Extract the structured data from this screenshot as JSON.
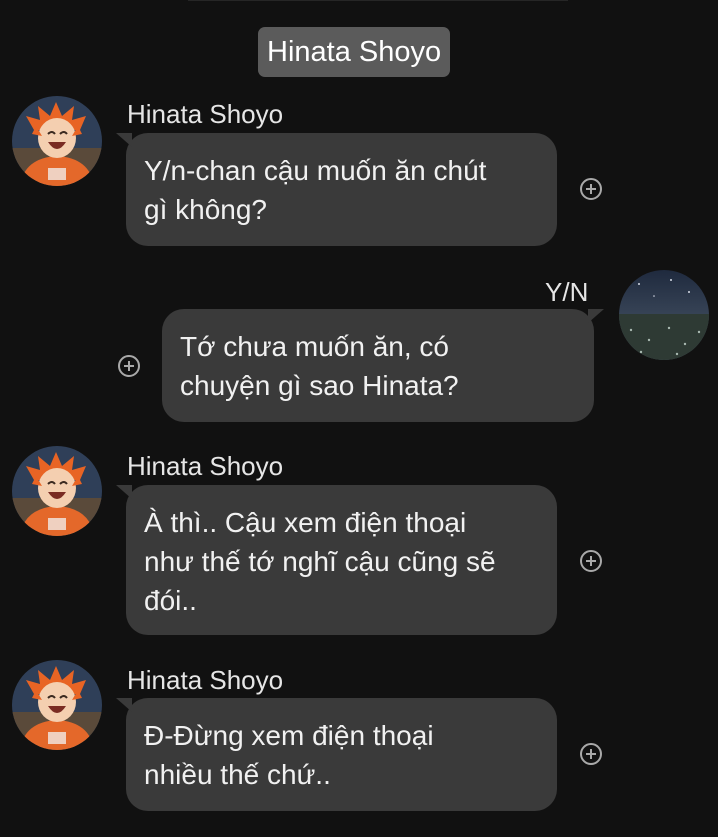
{
  "header": {
    "title": "Hinata Shoyo"
  },
  "messages": [
    {
      "sender": "Hinata Shoyo",
      "lines": [
        "Y/n-chan cậu muốn ăn chút",
        "gì không?"
      ]
    },
    {
      "sender": "Y/N",
      "lines": [
        "Tớ chưa muốn ăn, có",
        "chuyện gì sao Hinata?"
      ]
    },
    {
      "sender": "Hinata Shoyo",
      "lines": [
        "À thì.. Cậu xem điện thoại",
        "như thế tớ nghĩ cậu cũng sẽ",
        "đói.."
      ]
    },
    {
      "sender": "Hinata Shoyo",
      "lines": [
        "Đ-Đừng xem điện thoại",
        "nhiều thế chứ.."
      ]
    }
  ],
  "colors": {
    "background": "#111111",
    "bubble": "#3a3a3a",
    "header_pill": "#5b5b5b"
  },
  "icons": {
    "reaction": "add-reaction-icon",
    "avatar_hinata": "hinata-avatar",
    "avatar_user": "night-field-avatar"
  }
}
